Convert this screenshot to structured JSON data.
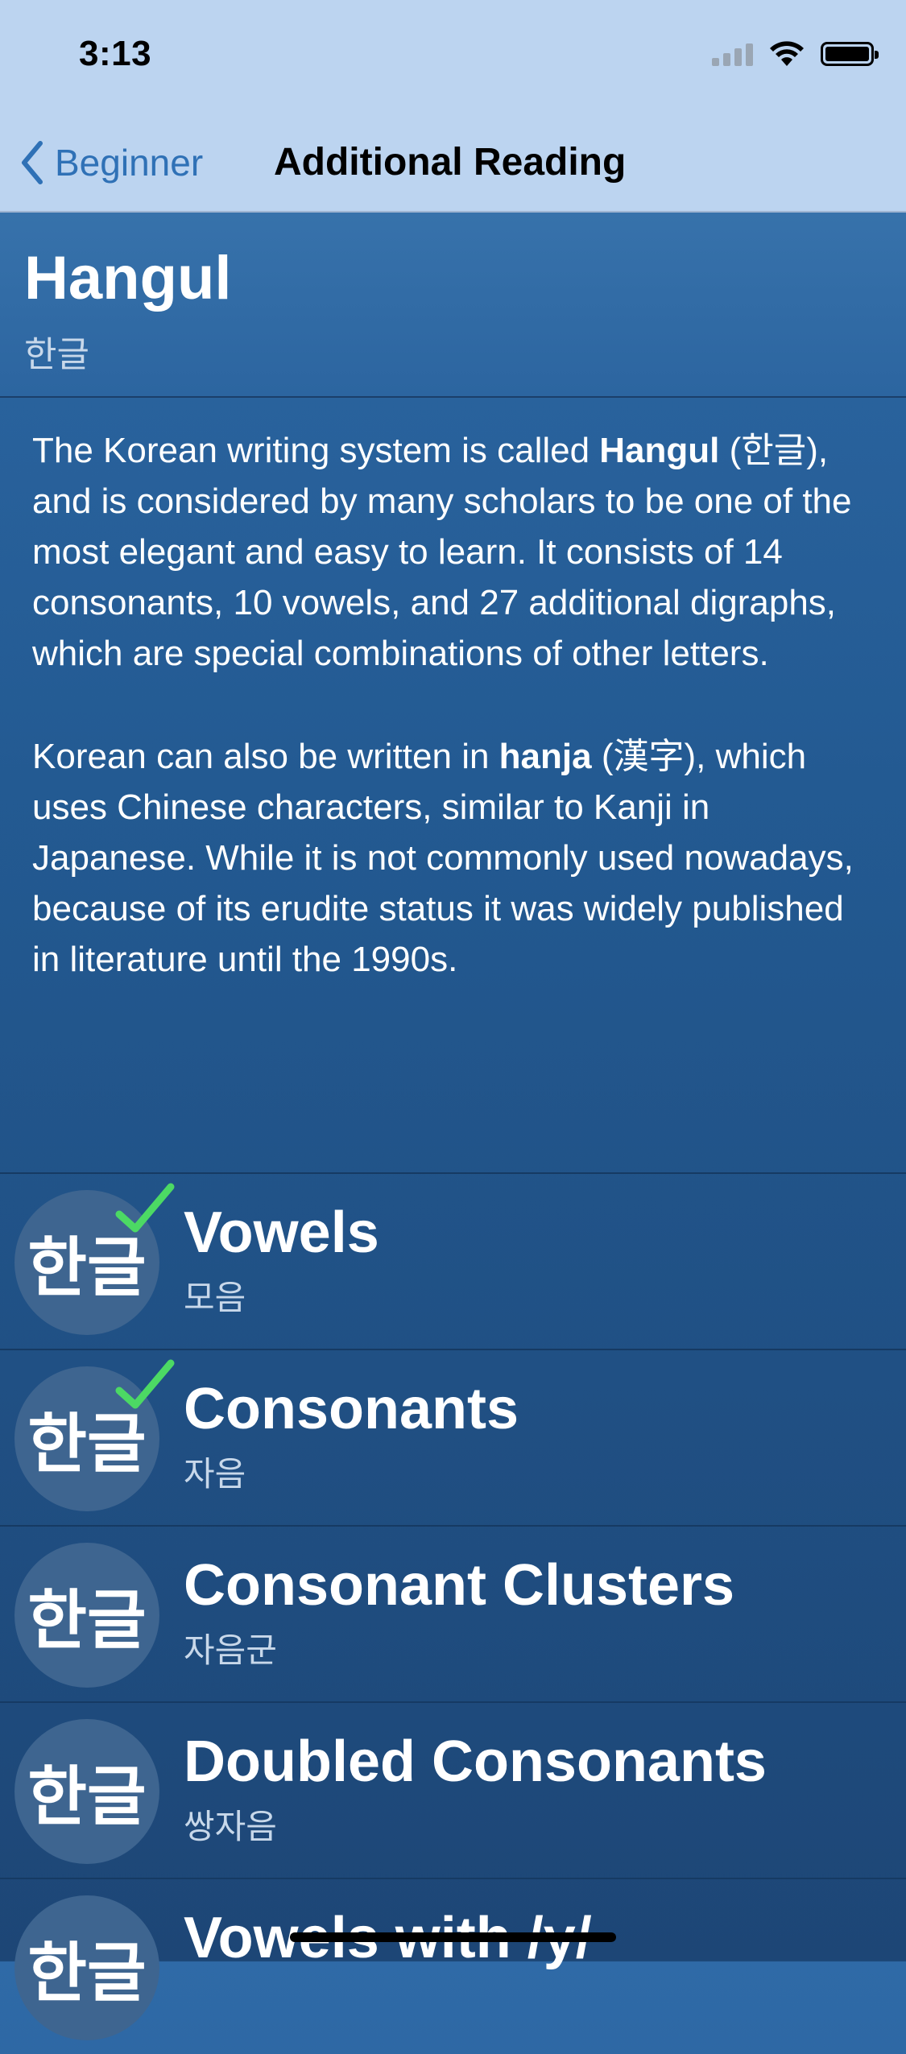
{
  "status_bar": {
    "time": "3:13"
  },
  "nav": {
    "back_label": "Beginner",
    "title": "Additional Reading"
  },
  "header": {
    "title": "Hangul",
    "subtitle": "한글"
  },
  "content": {
    "p1": {
      "before": "The Korean writing system is called ",
      "bold": "Hangul",
      "after": " (한글), and is considered by many scholars to be one of the most elegant and easy to learn. It consists of 14 consonants, 10 vowels, and 27 additional digraphs, which are special combinations of other letters."
    },
    "p2": {
      "before": "Korean can also be written in ",
      "bold": "hanja",
      "after": " (漢字), which uses Chinese characters, similar to Kanji in Japanese. While it is not commonly used nowadays, because of its erudite status it was widely published in literature until the 1990s."
    }
  },
  "lessons": [
    {
      "icon_text": "한글",
      "title": "Vowels",
      "subtitle": "모음",
      "completed": true
    },
    {
      "icon_text": "한글",
      "title": "Consonants",
      "subtitle": "자음",
      "completed": true
    },
    {
      "icon_text": "한글",
      "title": "Consonant Clusters",
      "subtitle": "자음군",
      "completed": false
    },
    {
      "icon_text": "한글",
      "title": "Doubled Consonants",
      "subtitle": "쌍자음",
      "completed": false
    },
    {
      "icon_text": "한글",
      "title": "Vowels with /y/",
      "subtitle": "",
      "completed": false
    }
  ],
  "colors": {
    "accent": "#2f71b6",
    "check": "#4cd964",
    "nav_bg": "#bcd4f0"
  }
}
